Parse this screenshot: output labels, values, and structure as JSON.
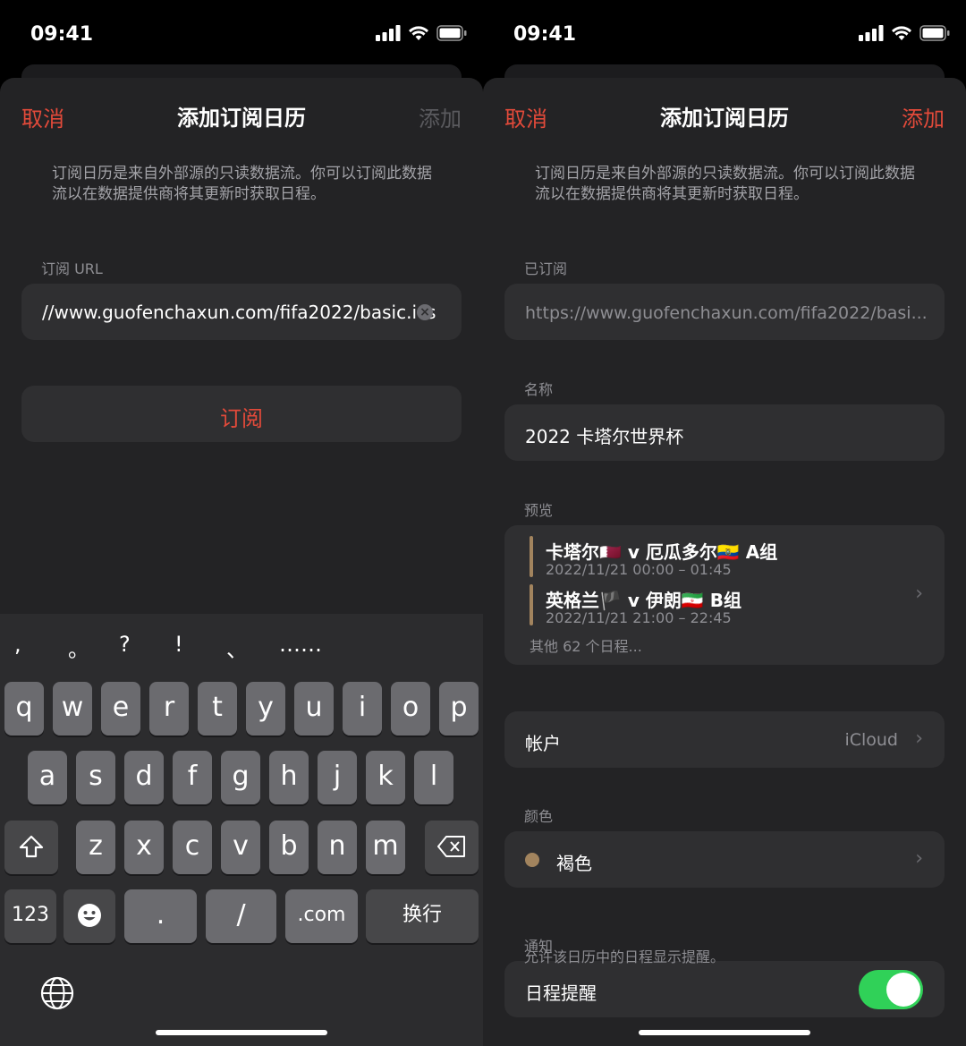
{
  "left": {
    "status": {
      "time": "09:41"
    },
    "nav": {
      "cancel": "取消",
      "title": "添加订阅日历",
      "add": "添加"
    },
    "description": "订阅日历是来自外部源的只读数据流。你可以订阅此数据流以在数据提供商将其更新时获取日程。",
    "url_label": "订阅 URL",
    "url_value": "//www.guofenchaxun.com/fifa2022/basic.ics",
    "subscribe_label": "订阅",
    "keyboard": {
      "punctuation": [
        ",",
        "。",
        "?",
        "!",
        "、",
        "……"
      ],
      "row1": [
        "q",
        "w",
        "e",
        "r",
        "t",
        "y",
        "u",
        "i",
        "o",
        "p"
      ],
      "row2": [
        "a",
        "s",
        "d",
        "f",
        "g",
        "h",
        "j",
        "k",
        "l"
      ],
      "row3": [
        "z",
        "x",
        "c",
        "v",
        "b",
        "n",
        "m"
      ],
      "numbers_key": "123",
      "dot_key": ".",
      "slash_key": "/",
      "com_key": ".com",
      "return_key": "换行"
    }
  },
  "right": {
    "status": {
      "time": "09:41"
    },
    "nav": {
      "cancel": "取消",
      "title": "添加订阅日历",
      "add": "添加"
    },
    "description": "订阅日历是来自外部源的只读数据流。你可以订阅此数据流以在数据提供商将其更新时获取日程。",
    "subscribed_label": "已订阅",
    "subscribed_url": "https://www.guofenchaxun.com/fifa2022/basi...",
    "name_label": "名称",
    "name_value": "2022 卡塔尔世界杯",
    "preview_label": "预览",
    "events": [
      {
        "title": "卡塔尔🇶🇦 v 厄瓜多尔🇪🇨 A组",
        "time": "2022/11/21 00:00 – 01:45"
      },
      {
        "title": "英格兰🏴 v 伊朗🇮🇷 B组",
        "time": "2022/11/21 21:00 – 22:45"
      }
    ],
    "more_events": "其他 62 个日程...",
    "account_label": "帐户",
    "account_value": "iCloud",
    "color_label": "颜色",
    "color_value": "褐色",
    "color_hex": "#a2845e",
    "notify_label": "通知",
    "alert_label": "日程提醒",
    "alert_on": true,
    "footnote": "允许该日历中的日程显示提醒。"
  },
  "accent_color": "#e24a3a",
  "toggle_color": "#30d158"
}
